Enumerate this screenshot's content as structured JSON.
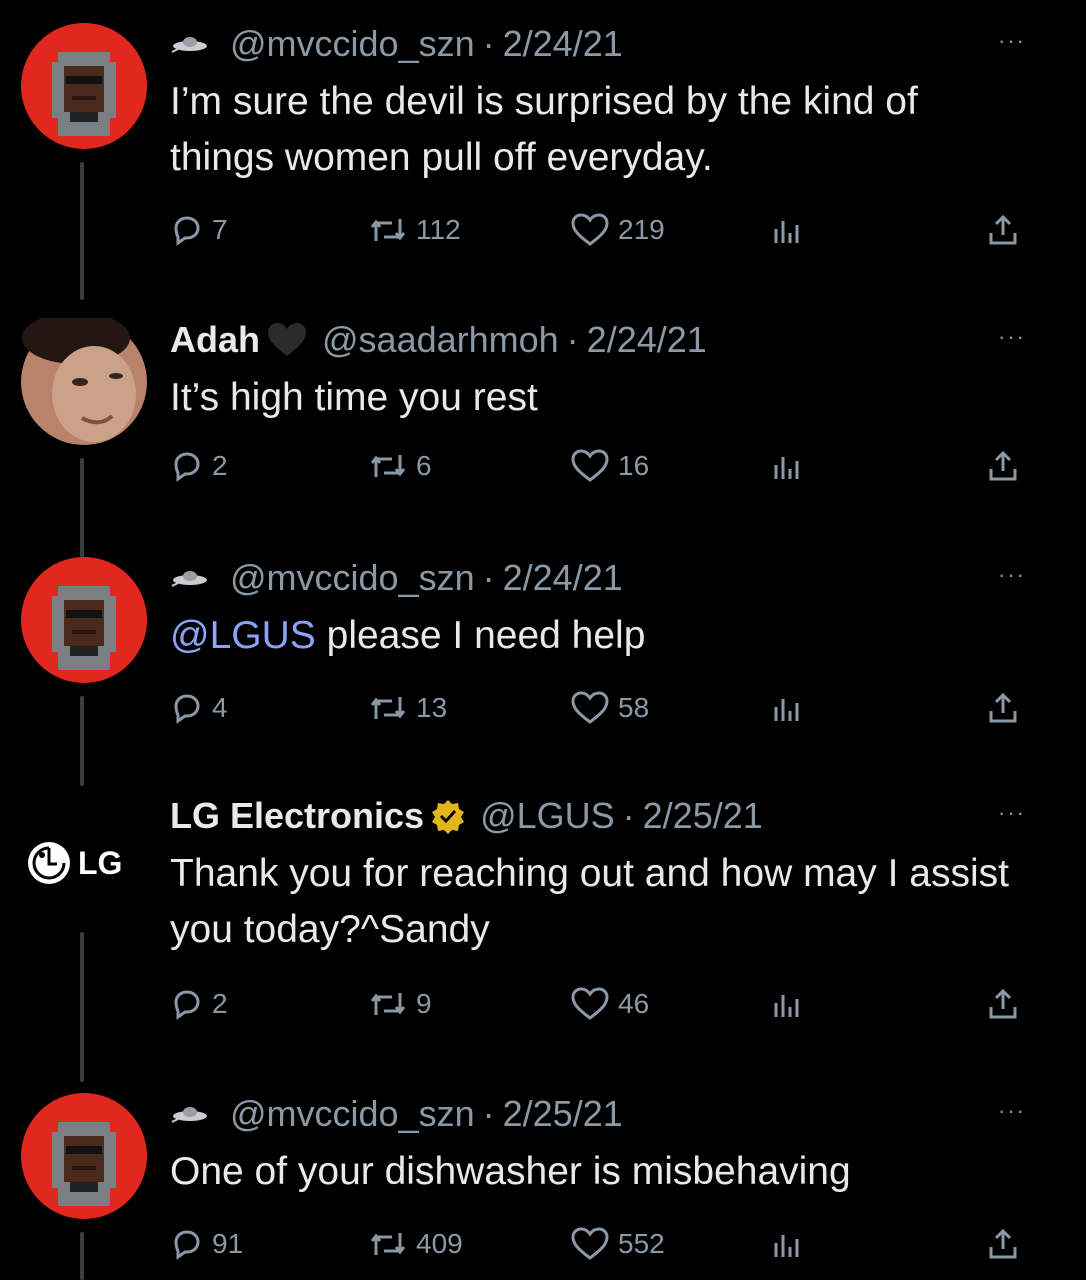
{
  "tweets": [
    {
      "user": {
        "name": "",
        "handle": "@mvccido_szn"
      },
      "sep": "·",
      "date": "2/24/21",
      "text": "I’m sure the devil is surprised by the kind of things women pull off everyday.",
      "mention": "",
      "stats": {
        "replies": "7",
        "retweets": "112",
        "likes": "219"
      }
    },
    {
      "user": {
        "name": "Adah",
        "handle": "@saadarhmoh"
      },
      "sep": "·",
      "date": "2/24/21",
      "text": "It’s high time you rest",
      "mention": "",
      "stats": {
        "replies": "2",
        "retweets": "6",
        "likes": "16"
      }
    },
    {
      "user": {
        "name": "",
        "handle": "@mvccido_szn"
      },
      "sep": "·",
      "date": "2/24/21",
      "text": "please I need help",
      "mention": "@LGUS",
      "stats": {
        "replies": "4",
        "retweets": "13",
        "likes": "58"
      }
    },
    {
      "user": {
        "name": "LG Electronics",
        "handle": "@LGUS",
        "logo_text": "LG"
      },
      "sep": "·",
      "date": "2/25/21",
      "text": "Thank you for reaching out and how may I assist you today?^Sandy",
      "mention": "",
      "stats": {
        "replies": "2",
        "retweets": "9",
        "likes": "46"
      }
    },
    {
      "user": {
        "name": "",
        "handle": "@mvccido_szn"
      },
      "sep": "·",
      "date": "2/25/21",
      "text": "One of your dishwasher is misbehaving",
      "mention": "",
      "stats": {
        "replies": "91",
        "retweets": "409",
        "likes": "552"
      }
    }
  ],
  "more_label": "···",
  "colors": {
    "background": "#000000",
    "text": "#e7e9ea",
    "muted": "#8b98a5",
    "mention": "#8aa3f4",
    "avatar_red": "#e0281f",
    "verified_gold": "#e2b719"
  }
}
